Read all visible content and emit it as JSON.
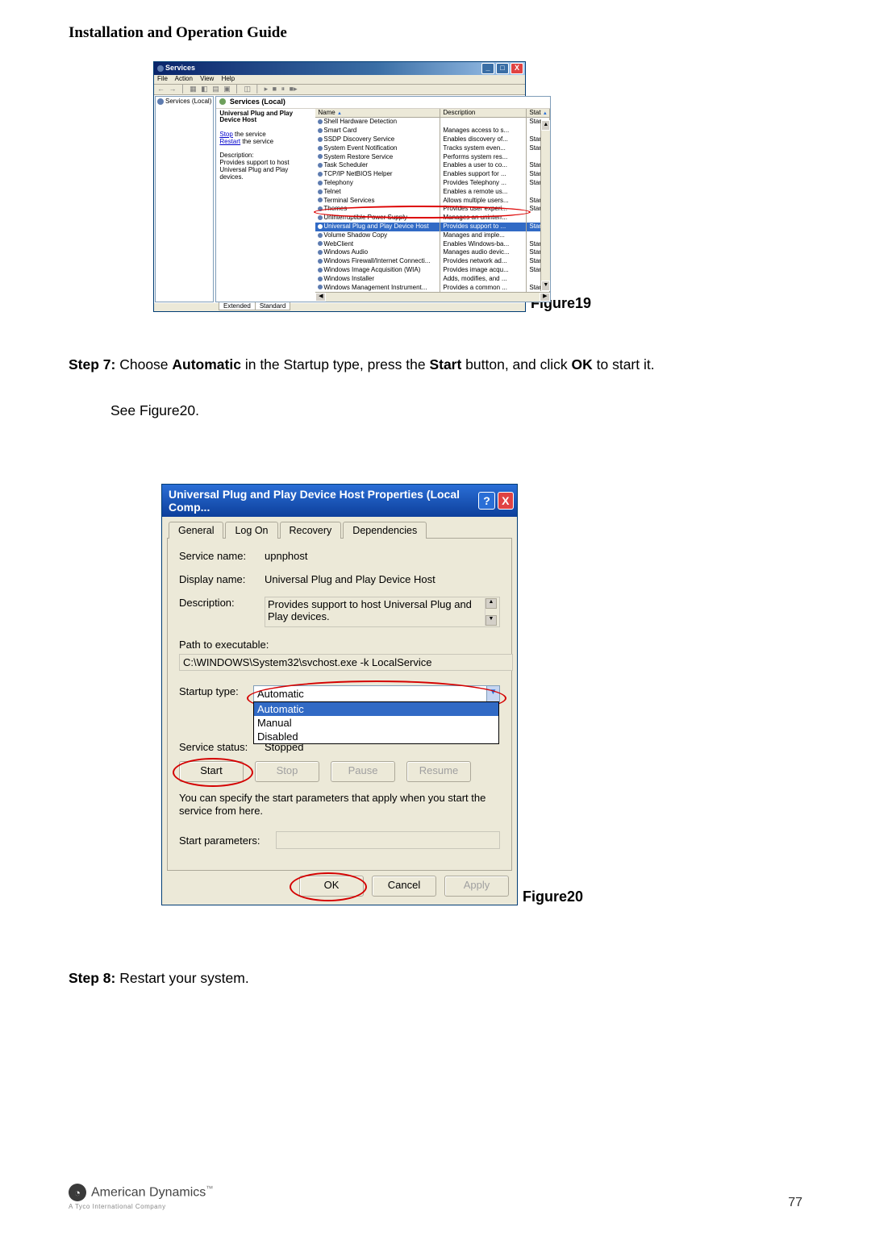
{
  "page_title": "Installation and Operation Guide",
  "figures": {
    "fig19_label": "Figure19",
    "fig20_label": "Figure20"
  },
  "step7": {
    "prefix": "Step 7:",
    "text_before": " Choose ",
    "bold1": "Automatic",
    "text_mid1": " in the Startup type, press the ",
    "bold2": "Start",
    "text_mid2": " button, and click ",
    "bold3": "OK",
    "text_after": " to start it."
  },
  "see_text": "See Figure20.",
  "step8": {
    "prefix": "Step 8:",
    "text": " Restart your system."
  },
  "services_window": {
    "title": "Services",
    "menu": [
      "File",
      "Action",
      "View",
      "Help"
    ],
    "tree_item": "Services (Local)",
    "panel_header": "Services (Local)",
    "detail_title": "Universal Plug and Play Device Host",
    "detail_stop": "Stop",
    "detail_stop_suffix": " the service",
    "detail_restart": "Restart",
    "detail_restart_suffix": " the service",
    "detail_desc_hdr": "Description:",
    "detail_desc": "Provides support to host Universal Plug and Play devices.",
    "columns": {
      "name": "Name",
      "desc": "Description",
      "status": "Stat"
    },
    "rows": [
      {
        "name": "Shell Hardware Detection",
        "desc": "",
        "stat": "Star"
      },
      {
        "name": "Smart Card",
        "desc": "Manages access to s...",
        "stat": ""
      },
      {
        "name": "SSDP Discovery Service",
        "desc": "Enables discovery of...",
        "stat": "Star"
      },
      {
        "name": "System Event Notification",
        "desc": "Tracks system even...",
        "stat": "Star"
      },
      {
        "name": "System Restore Service",
        "desc": "Performs system res...",
        "stat": ""
      },
      {
        "name": "Task Scheduler",
        "desc": "Enables a user to co...",
        "stat": "Star"
      },
      {
        "name": "TCP/IP NetBIOS Helper",
        "desc": "Enables support for ...",
        "stat": "Star"
      },
      {
        "name": "Telephony",
        "desc": "Provides Telephony ...",
        "stat": "Star"
      },
      {
        "name": "Telnet",
        "desc": "Enables a remote us...",
        "stat": ""
      },
      {
        "name": "Terminal Services",
        "desc": "Allows multiple users...",
        "stat": "Star"
      },
      {
        "name": "Themes",
        "desc": "Provides user experi...",
        "stat": "Star"
      },
      {
        "name": "Uninterruptible Power Supply",
        "desc": "Manages an uninterr...",
        "stat": ""
      },
      {
        "name": "Universal Plug and Play Device Host",
        "desc": "Provides support to ...",
        "stat": "Star",
        "sel": true
      },
      {
        "name": "Volume Shadow Copy",
        "desc": "Manages and imple...",
        "stat": ""
      },
      {
        "name": "WebClient",
        "desc": "Enables Windows-ba...",
        "stat": "Star"
      },
      {
        "name": "Windows Audio",
        "desc": "Manages audio devic...",
        "stat": "Star"
      },
      {
        "name": "Windows Firewall/Internet Connecti...",
        "desc": "Provides network ad...",
        "stat": "Star"
      },
      {
        "name": "Windows Image Acquisition (WIA)",
        "desc": "Provides image acqu...",
        "stat": "Star"
      },
      {
        "name": "Windows Installer",
        "desc": "Adds, modifies, and ...",
        "stat": ""
      },
      {
        "name": "Windows Management Instrument...",
        "desc": "Provides a common ...",
        "stat": "Star"
      }
    ],
    "tabs": {
      "extended": "Extended",
      "standard": "Standard"
    }
  },
  "properties_dialog": {
    "title": "Universal Plug and Play Device Host Properties (Local Comp...",
    "tabs": [
      "General",
      "Log On",
      "Recovery",
      "Dependencies"
    ],
    "fields": {
      "service_name_lbl": "Service name:",
      "service_name": "upnphost",
      "display_name_lbl": "Display name:",
      "display_name": "Universal Plug and Play Device Host",
      "description_lbl": "Description:",
      "description": "Provides support to host Universal Plug and Play devices.",
      "path_lbl": "Path to executable:",
      "path": "C:\\WINDOWS\\System32\\svchost.exe -k LocalService",
      "startup_lbl": "Startup type:",
      "startup_value": "Automatic",
      "startup_options": [
        "Automatic",
        "Manual",
        "Disabled"
      ],
      "status_lbl": "Service status:",
      "status": "Stopped",
      "note": "You can specify the start parameters that apply when you start the service from here.",
      "start_params_lbl": "Start parameters:"
    },
    "buttons": {
      "start": "Start",
      "stop": "Stop",
      "pause": "Pause",
      "resume": "Resume",
      "ok": "OK",
      "cancel": "Cancel",
      "apply": "Apply"
    }
  },
  "footer": {
    "brand": "American Dynamics",
    "tagline": "A Tyco International Company",
    "page": "77"
  }
}
